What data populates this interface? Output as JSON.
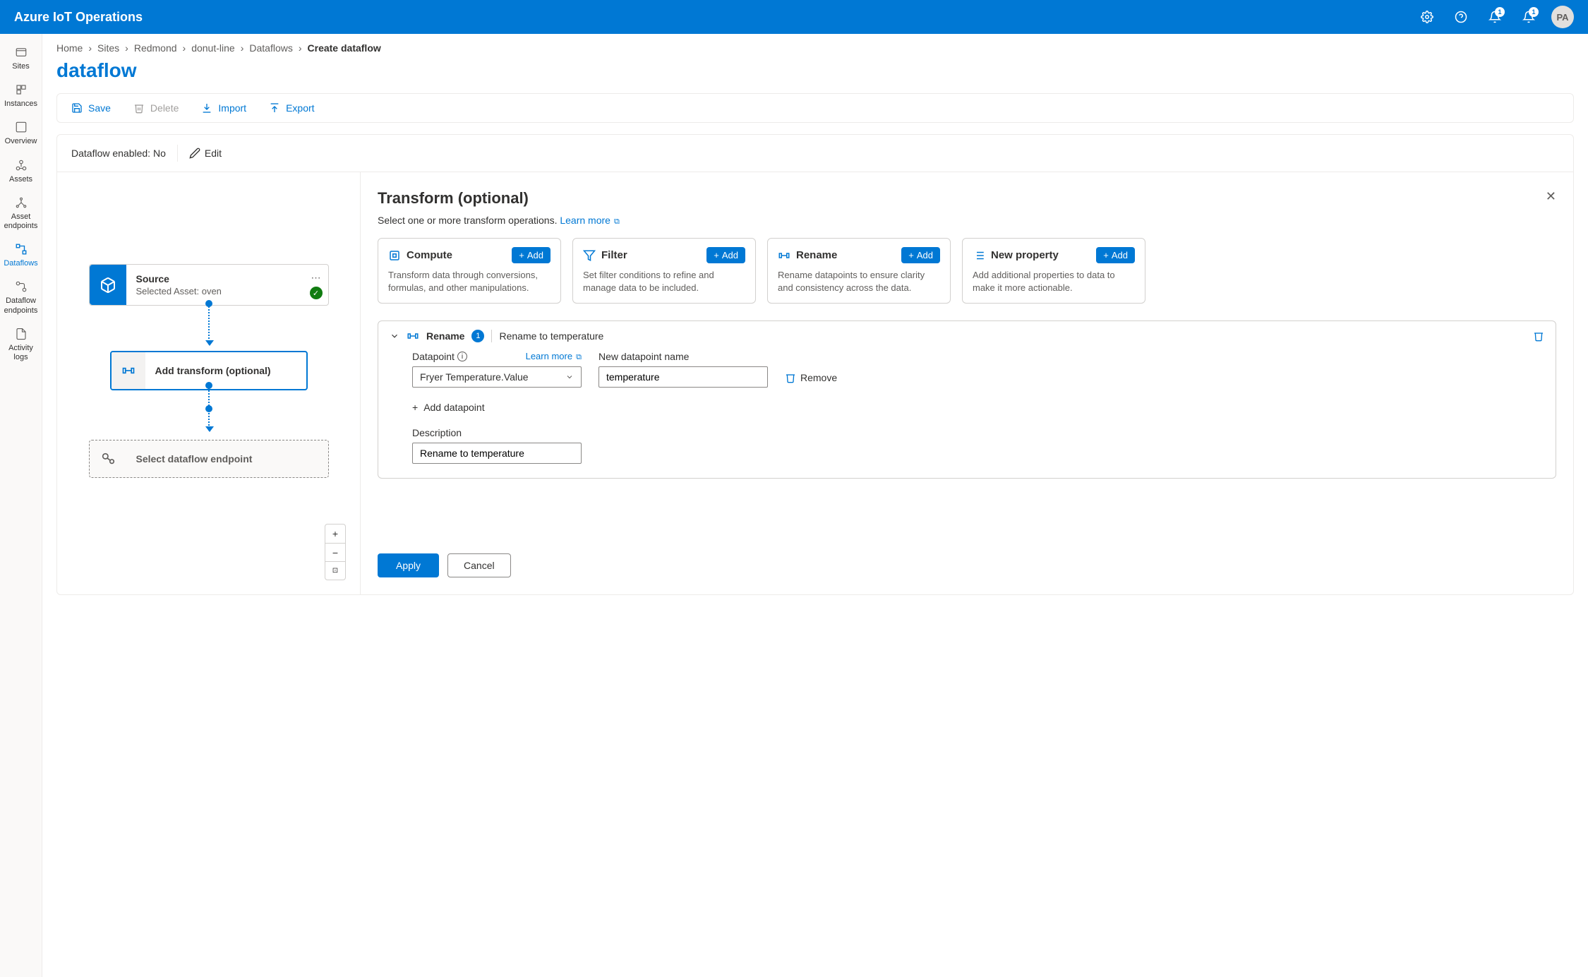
{
  "header": {
    "title": "Azure IoT Operations",
    "notif_badge_1": "1",
    "notif_badge_2": "1",
    "avatar": "PA"
  },
  "sidebar": {
    "items": [
      {
        "label": "Sites"
      },
      {
        "label": "Instances"
      },
      {
        "label": "Overview"
      },
      {
        "label": "Assets"
      },
      {
        "label": "Asset endpoints"
      },
      {
        "label": "Dataflows"
      },
      {
        "label": "Dataflow endpoints"
      },
      {
        "label": "Activity logs"
      }
    ]
  },
  "breadcrumb": {
    "items": [
      "Home",
      "Sites",
      "Redmond",
      "donut-line",
      "Dataflows"
    ],
    "current": "Create dataflow"
  },
  "page_title": "dataflow",
  "toolbar": {
    "save": "Save",
    "delete": "Delete",
    "import": "Import",
    "export": "Export"
  },
  "status": {
    "enabled_label": "Dataflow enabled: No",
    "edit": "Edit"
  },
  "canvas": {
    "source": {
      "title": "Source",
      "sub": "Selected Asset: oven"
    },
    "transform": {
      "label": "Add transform (optional)"
    },
    "endpoint": {
      "label": "Select dataflow endpoint"
    }
  },
  "details": {
    "title": "Transform (optional)",
    "subtitle": "Select one or more transform operations.",
    "learn_more": "Learn more",
    "ops": [
      {
        "title": "Compute",
        "desc": "Transform data through conversions, formulas, and other manipulations.",
        "add": "Add"
      },
      {
        "title": "Filter",
        "desc": "Set filter conditions to refine and manage data to be included.",
        "add": "Add"
      },
      {
        "title": "Rename",
        "desc": "Rename datapoints to ensure clarity and consistency across the data.",
        "add": "Add"
      },
      {
        "title": "New property",
        "desc": "Add additional properties to data to make it more actionable.",
        "add": "Add"
      }
    ],
    "rename_section": {
      "label": "Rename",
      "count": "1",
      "summary": "Rename to temperature",
      "datapoint_label": "Datapoint",
      "learn_more": "Learn more",
      "datapoint_value": "Fryer Temperature.Value",
      "new_name_label": "New datapoint name",
      "new_name_value": "temperature",
      "remove": "Remove",
      "add_datapoint": "Add datapoint",
      "description_label": "Description",
      "description_value": "Rename to temperature"
    },
    "apply": "Apply",
    "cancel": "Cancel"
  }
}
